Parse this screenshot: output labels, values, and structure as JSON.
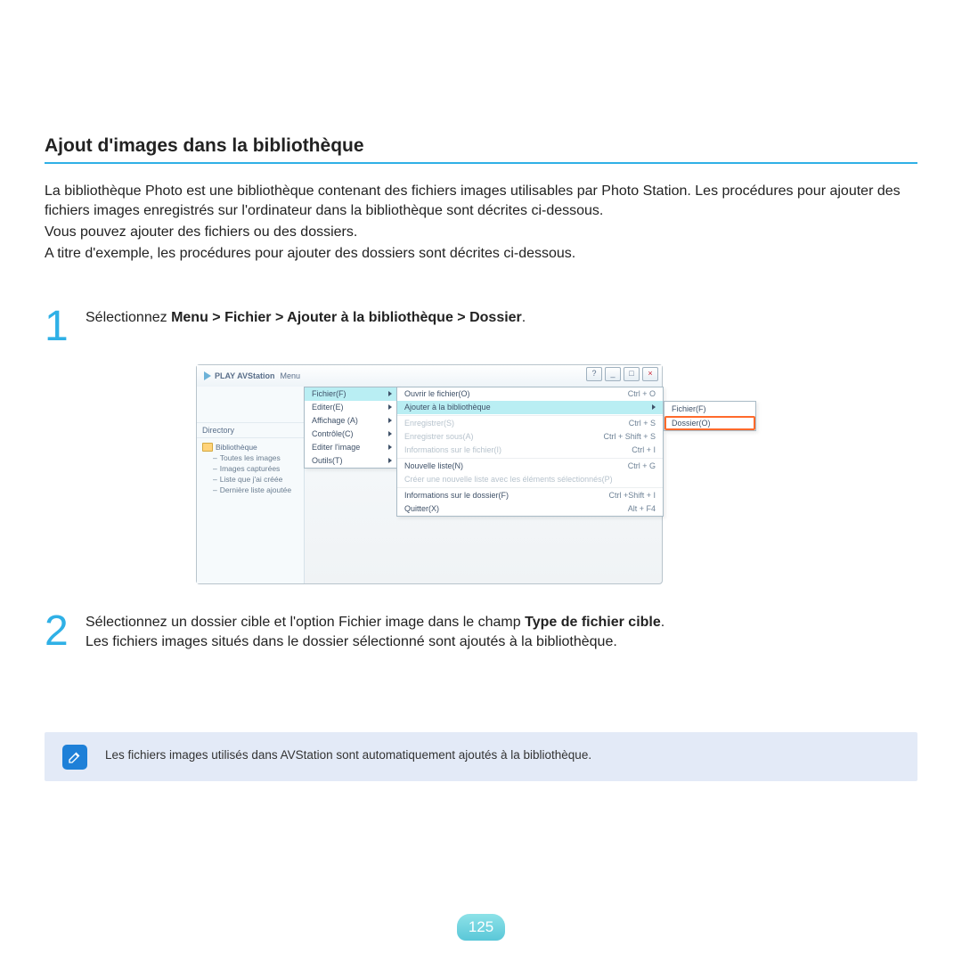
{
  "section": {
    "title": "Ajout d'images dans la bibliothèque",
    "intro1": "La bibliothèque Photo est une bibliothèque contenant des fichiers images utilisables par Photo Station. Les procédures pour ajouter des fichiers images enregistrés sur l'ordinateur dans la bibliothèque sont décrites ci-dessous.",
    "intro2": "Vous pouvez ajouter des fichiers ou des dossiers.",
    "intro3": "A titre d'exemple, les procédures pour ajouter des dossiers sont décrites ci-dessous."
  },
  "steps": {
    "one": {
      "num": "1",
      "pre": "Sélectionnez ",
      "path": "Menu > Fichier > Ajouter à la bibliothèque > Dossier",
      "post": "."
    },
    "two": {
      "num": "2",
      "l1a": "Sélectionnez un dossier cible et l'option Fichier image dans le champ ",
      "l1b": "Type de fichier cible",
      "l1c": ".",
      "l2": "Les fichiers images situés dans le dossier sélectionné sont ajoutés à la bibliothèque."
    }
  },
  "note": {
    "text": "Les fichiers images utilisés dans AVStation sont automatiquement ajoutés à la bibliothèque."
  },
  "page_number": "125",
  "screenshot": {
    "window": {
      "title": "PLAY AVStation",
      "menu_label": "Menu",
      "directory_label": "Directory",
      "tree_root": "Bibliothèque",
      "tree_items": [
        "Toutes les images",
        "Images capturées",
        "Liste que j'ai créée",
        "Dernière liste ajoutée"
      ]
    },
    "menu1": [
      "Fichier(F)",
      "Editer(E)",
      "Affichage (A)",
      "Contrôle(C)",
      "Editer l'image",
      "Outils(T)"
    ],
    "menu2": [
      {
        "label": "Ouvrir le fichier(O)",
        "shortcut": "Ctrl + O"
      },
      {
        "label": "Ajouter à la bibliothèque",
        "submenu": true
      },
      {
        "label": "Enregistrer(S)",
        "shortcut": "Ctrl + S",
        "disabled": true
      },
      {
        "label": "Enregistrer sous(A)",
        "shortcut": "Ctrl + Shift + S",
        "disabled": true
      },
      {
        "label": "Informations sur le fichier(I)",
        "shortcut": "Ctrl + I",
        "disabled": true
      },
      {
        "label": "Nouvelle liste(N)",
        "shortcut": "Ctrl + G"
      },
      {
        "label": "Créer une nouvelle liste avec les éléments sélectionnés(P)",
        "disabled": true
      },
      {
        "label": "Informations sur le dossier(F)",
        "shortcut": "Ctrl +Shift + I"
      },
      {
        "label": "Quitter(X)",
        "shortcut": "Alt + F4"
      }
    ],
    "menu3": [
      "Fichier(F)",
      "Dossier(O)"
    ]
  }
}
